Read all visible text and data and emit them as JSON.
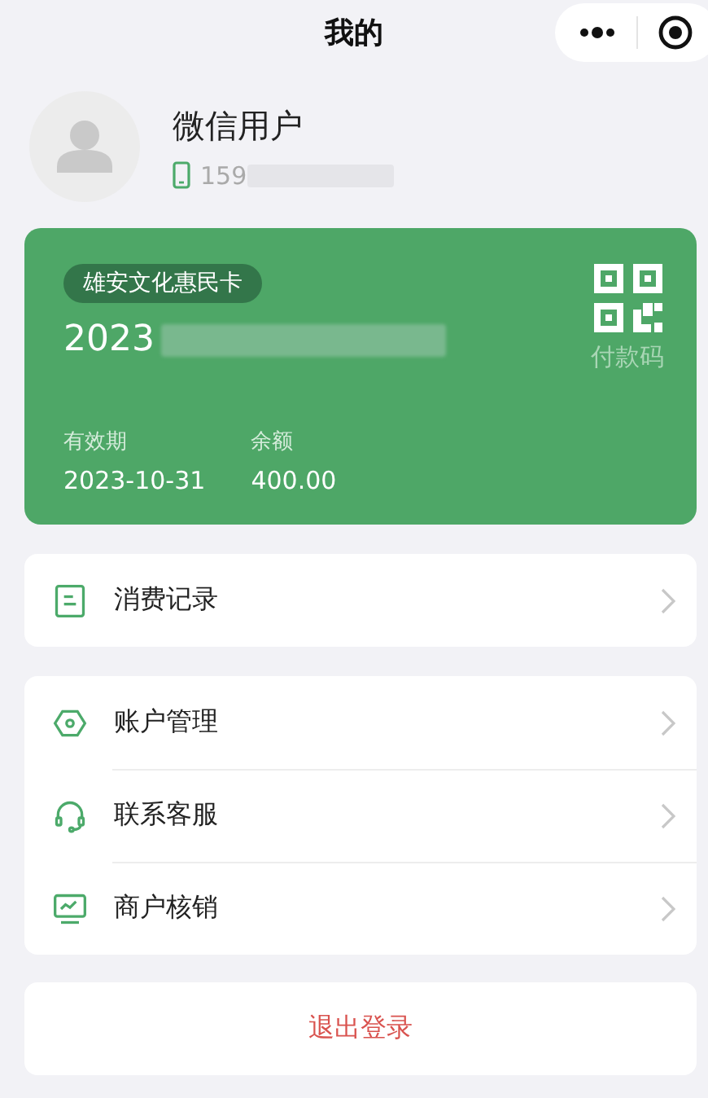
{
  "header": {
    "title": "我的"
  },
  "profile": {
    "name": "微信用户",
    "phone": "159"
  },
  "card": {
    "badge": "雄安文化惠民卡",
    "number": "2023",
    "pay_label": "付款码",
    "expiry_label": "有效期",
    "expiry": "2023-10-31",
    "balance_label": "余额",
    "balance": "400.00"
  },
  "menu_groups": [
    [
      {
        "kind": "record",
        "label": "消费记录"
      }
    ],
    [
      {
        "kind": "account",
        "label": "账户管理"
      },
      {
        "kind": "service",
        "label": "联系客服"
      },
      {
        "kind": "merchant",
        "label": "商户核销"
      }
    ]
  ],
  "logout": "退出登录"
}
